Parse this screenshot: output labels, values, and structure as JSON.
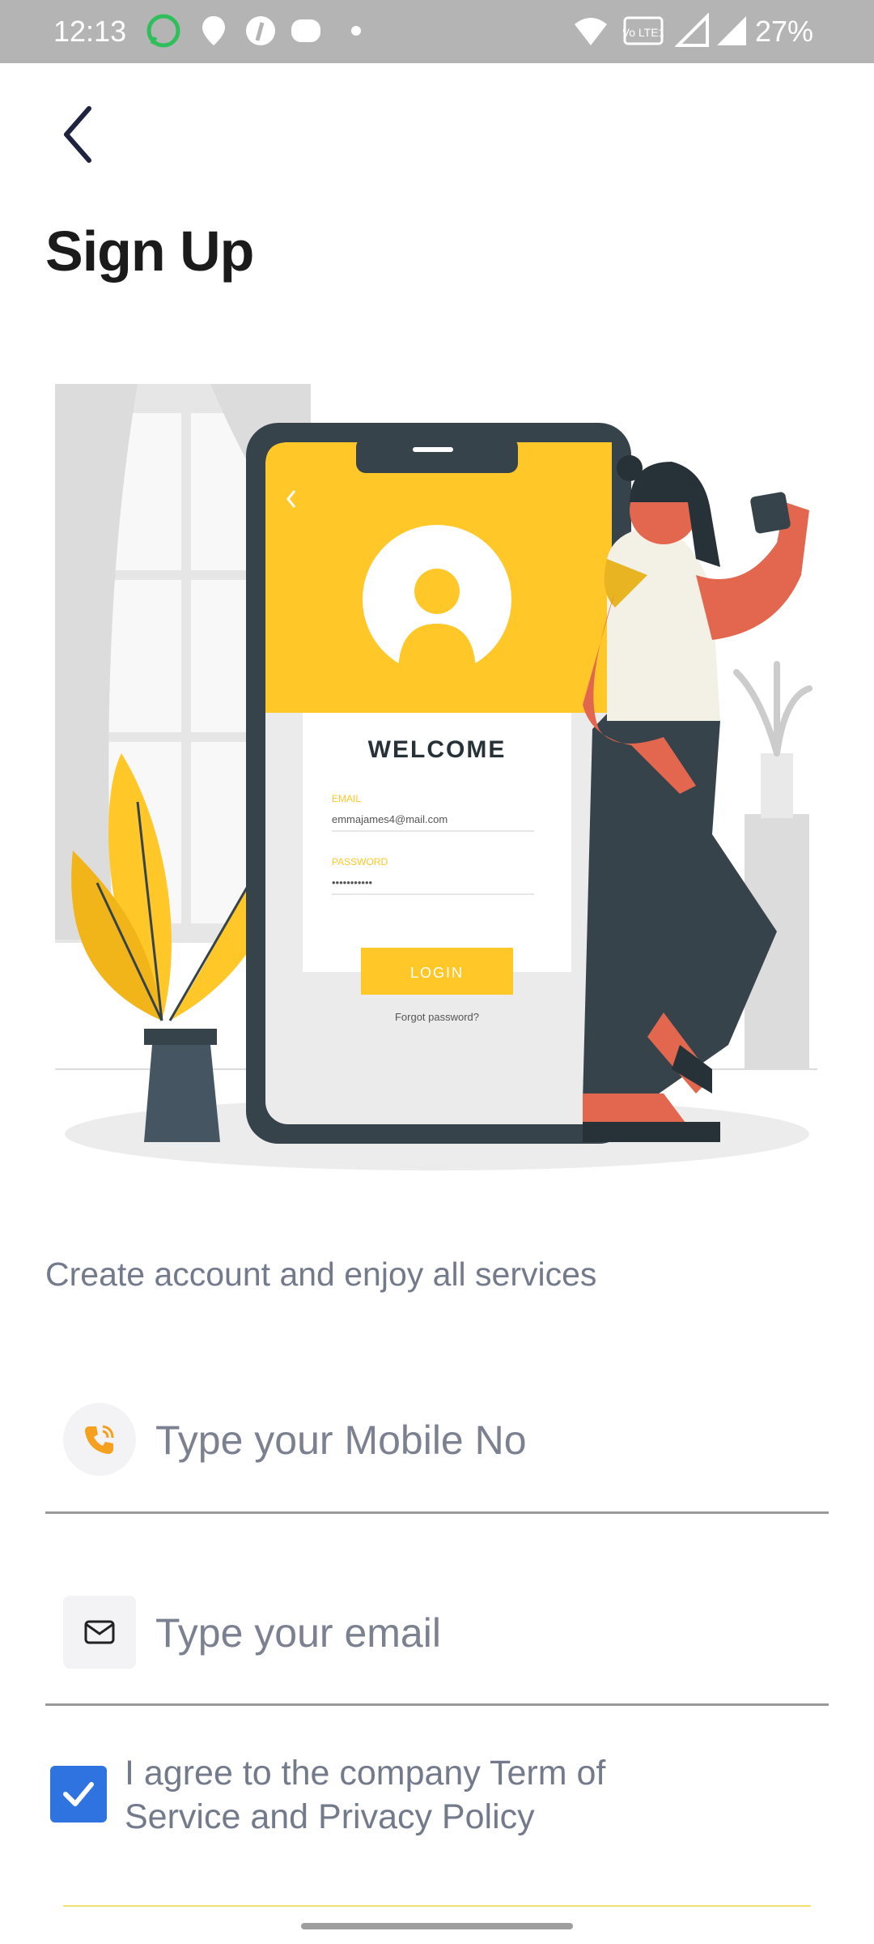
{
  "status_bar": {
    "time": "12:13",
    "battery": "27%",
    "network_badge": "Vo LTE1",
    "icons": [
      "whatsapp-icon",
      "location-icon",
      "app-icon",
      "app-icon",
      "dot-icon",
      "wifi-icon",
      "signal-icon",
      "signal-icon"
    ]
  },
  "header": {
    "back_icon": "chevron-left-icon",
    "title": "Sign Up"
  },
  "illustration": {
    "welcome": "WELCOME",
    "email_label": "EMAIL",
    "email_value": "emmajames4@mail.com",
    "password_label": "PASSWORD",
    "password_value": "•••••••••••",
    "login_label": "LOGIN",
    "forgot_label": "Forgot password?"
  },
  "form": {
    "subtitle": "Create account and enjoy all services",
    "mobile_placeholder": "Type your Mobile No",
    "email_placeholder": "Type your email",
    "agree_text": "I agree to the company Term of Service and Privacy Policy",
    "agree_checked": true
  },
  "colors": {
    "accent_yellow": "#ffc728",
    "checkbox_blue": "#2f73e0",
    "text_gray": "#727a8c",
    "dark": "#37434a"
  }
}
